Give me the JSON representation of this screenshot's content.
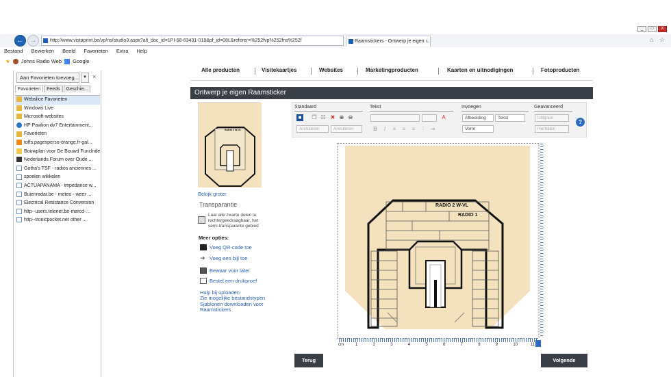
{
  "browser": {
    "url": "http://www.vistaprint.be/vp/ns/studio3.aspx?alt_doc_id=1PI-68-63431-018&pf_id=08L&referer=%252fvp%252fns%252f",
    "tab_title": "Raamstickers - Ontwerp je eigen ...",
    "tab_close": "×",
    "home_icons": "⌂ ☆",
    "win_min": "_",
    "win_max": "□",
    "win_close": "X",
    "menu": [
      "Bestand",
      "Bewerken",
      "Beeld",
      "Favorieten",
      "Extra",
      "Help"
    ],
    "fav_bar": [
      "Johns Radio Web",
      "Google"
    ]
  },
  "sidebar": {
    "add_button": "Aan Favorieten toevoeg...",
    "close": "×",
    "tabs": [
      "Favorieten",
      "Feeds",
      "Geschie..."
    ],
    "items": [
      {
        "label": "Webslice Favorieten",
        "icon": "folder"
      },
      {
        "label": "Windows Live",
        "icon": "folder"
      },
      {
        "label": "Microsoft-websites",
        "icon": "folder"
      },
      {
        "label": "HP Pavilion dv7 Entertainment...",
        "icon": "blue"
      },
      {
        "label": "Favorieten",
        "icon": "folder"
      },
      {
        "label": "toffs.pagesperso-orange.fr-gal...",
        "icon": "orange"
      },
      {
        "label": "Bouwplan voor De Bouwd Funclnde...",
        "icon": "yellow"
      },
      {
        "label": "Nederlands Forum over Oude ...",
        "icon": "dark"
      },
      {
        "label": "Gotha's TSF - radios anciennes ...",
        "icon": "page"
      },
      {
        "label": "spoelen wikkelen",
        "icon": "page"
      },
      {
        "label": "ACTUAPANAMA - impedance w...",
        "icon": "page"
      },
      {
        "label": "Buienradar.be - meteo - weer ...",
        "icon": "page"
      },
      {
        "label": "Electrical Resistance Conversion",
        "icon": "page"
      },
      {
        "label": "http--users.telenet.be-marcd-...",
        "icon": "page"
      },
      {
        "label": "http--tronicpocket.net other ...",
        "icon": "page"
      }
    ]
  },
  "site": {
    "nav": [
      "Alle producten",
      "Visitekaartjes",
      "Websites",
      "Marketingproducten",
      "Kaarten en uitnodigingen",
      "Fotoproducten"
    ],
    "header": "Ontwerp je eigen Raamsticker",
    "bekijk_groter": "Bekijk groter",
    "transparantie": "Transparantie",
    "transparantie_desc": "Laat alle zwarte delen te rechtergeedraagbaar, het semi-transparante gebied",
    "meer_opties": "Meer opties:",
    "options": [
      "Voeg QR-code toe",
      "Voeg een bijl toe",
      "Bewaar voor later",
      "Bestel een drukproef"
    ],
    "links": [
      "Hulp bij uploaden",
      "Zie mogelijke bestandstypen",
      "Sjablonen downloaden voor",
      "Raamstickers"
    ],
    "back_button": "Terug",
    "next_button": "Volgende"
  },
  "toolbar": {
    "groups": [
      "Standaard",
      "Tekst",
      "Invoegen",
      "Geavanceerd"
    ],
    "undo": "Annuleren",
    "redo": "Annuleren",
    "insert_image": "Afbeelding",
    "insert_text": "Tekst",
    "insert_shape": "Vorm",
    "advanced_1": "Uitlijnen",
    "advanced_2": "Herhalen",
    "help": "?"
  },
  "design": {
    "label_top": "RADIO 2 W-VL",
    "label_2": "RADIO 1",
    "thumb_label": "RADIO 2 W-VL"
  },
  "ruler": {
    "numbers": [
      "1",
      "2",
      "3",
      "4",
      "5",
      "6",
      "7",
      "8",
      "9",
      "10",
      "11"
    ],
    "origin": "cm"
  }
}
